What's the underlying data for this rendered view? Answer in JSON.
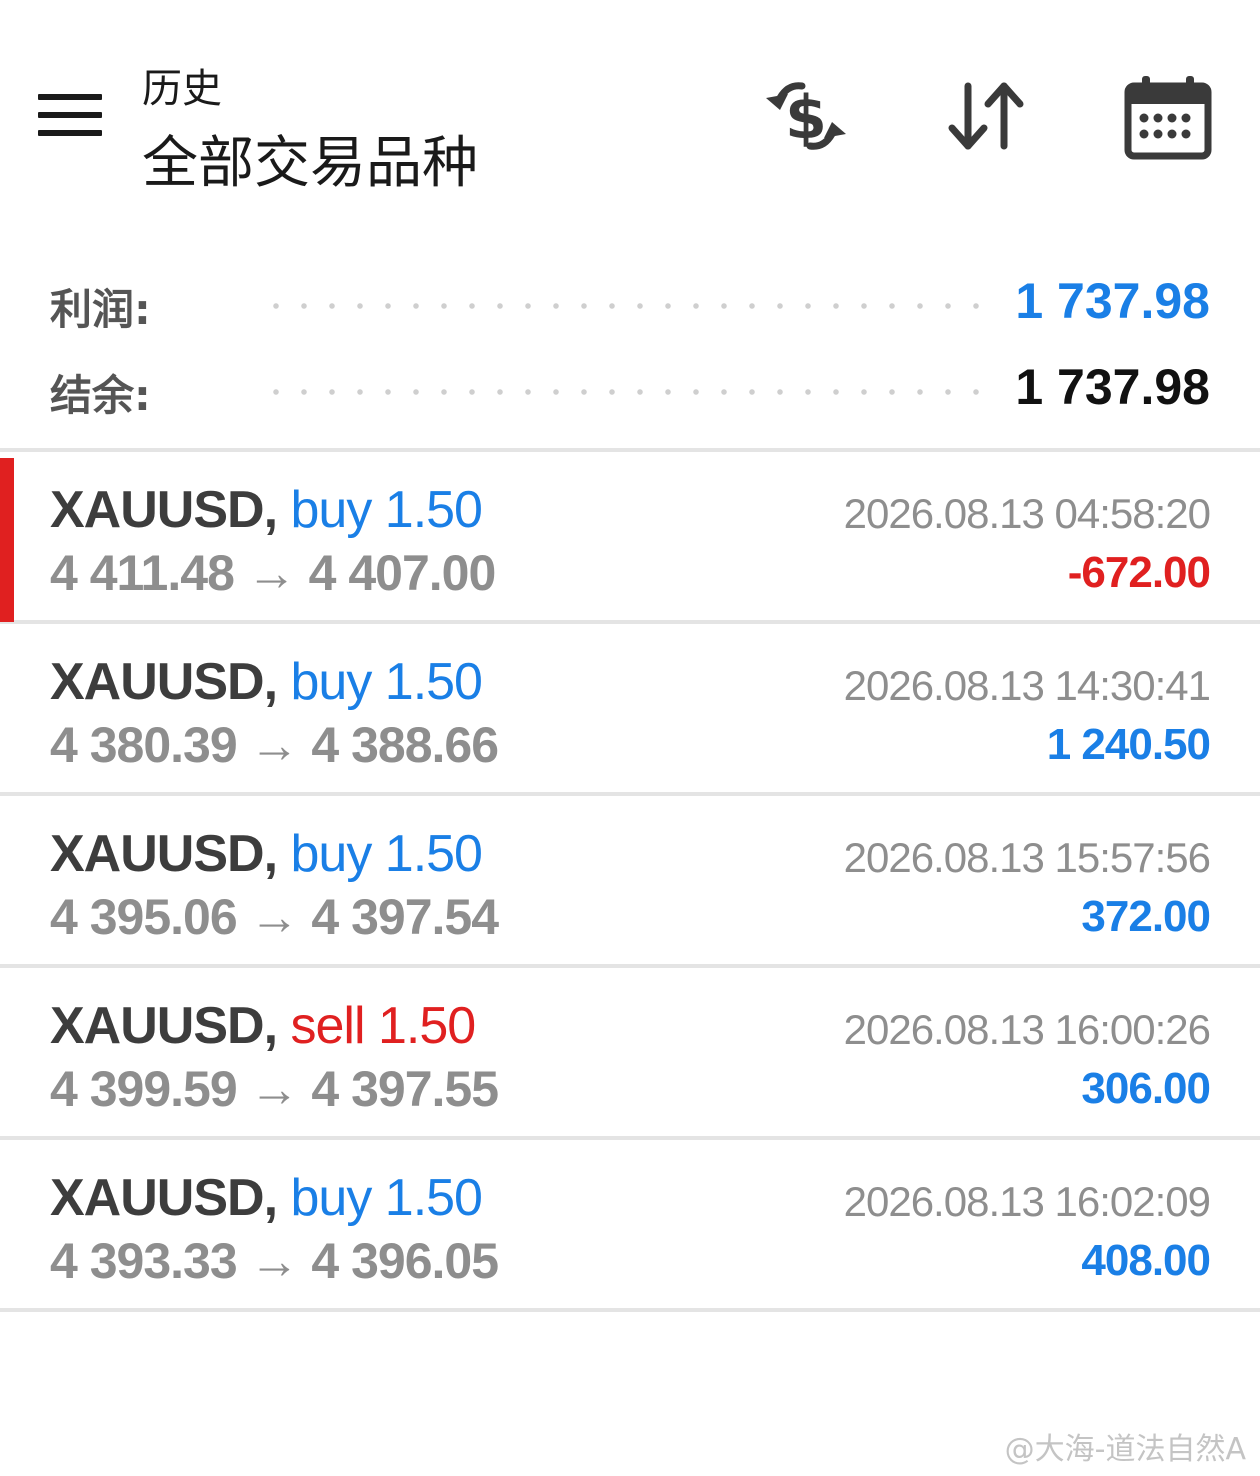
{
  "header": {
    "title": "历史",
    "subtitle": "全部交易品种",
    "icons": [
      "menu-icon",
      "currency-exchange-icon",
      "sort-icon",
      "calendar-icon"
    ]
  },
  "summary": {
    "profit_label": "利润:",
    "profit_value": "1 737.98",
    "balance_label": "结余:",
    "balance_value": "1 737.98"
  },
  "colors": {
    "blue": "#1a7fe6",
    "red": "#e02020",
    "dark": "#1a1a1a",
    "gray": "#8e8e8e"
  },
  "trades": [
    {
      "symbol": "XAUUSD,",
      "side": "buy 1.50",
      "side_type": "buy",
      "prices": "4 411.48 → 4 407.00",
      "time": "2026.08.13 04:58:20",
      "profit": "-672.00",
      "profit_type": "loss",
      "highlighted": true
    },
    {
      "symbol": "XAUUSD,",
      "side": "buy 1.50",
      "side_type": "buy",
      "prices": "4 380.39 → 4 388.66",
      "time": "2026.08.13 14:30:41",
      "profit": "1 240.50",
      "profit_type": "gain",
      "highlighted": false
    },
    {
      "symbol": "XAUUSD,",
      "side": "buy 1.50",
      "side_type": "buy",
      "prices": "4 395.06 → 4 397.54",
      "time": "2026.08.13 15:57:56",
      "profit": "372.00",
      "profit_type": "gain",
      "highlighted": false
    },
    {
      "symbol": "XAUUSD,",
      "side": "sell 1.50",
      "side_type": "sell",
      "prices": "4 399.59 → 4 397.55",
      "time": "2026.08.13 16:00:26",
      "profit": "306.00",
      "profit_type": "gain",
      "highlighted": false
    },
    {
      "symbol": "XAUUSD,",
      "side": "buy 1.50",
      "side_type": "buy",
      "prices": "4 393.33 → 4 396.05",
      "time": "2026.08.13 16:02:09",
      "profit": "408.00",
      "profit_type": "gain",
      "highlighted": false
    }
  ],
  "watermark": "@大海-道法自然A"
}
